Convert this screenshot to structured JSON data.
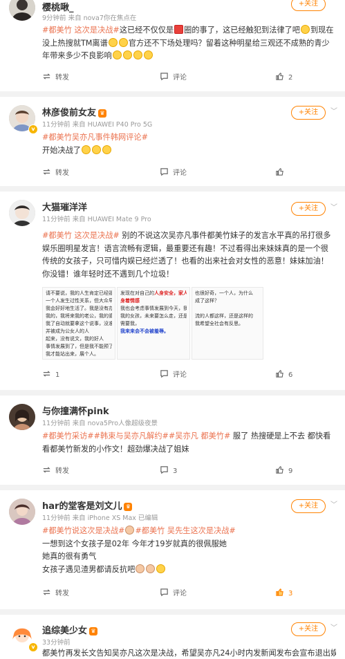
{
  "posts": [
    {
      "name": "樱桃啾_",
      "meta": "9分钟前  来自 nova7你在焦点在",
      "follow": "+关注",
      "tag1": "#都美竹 这次是决战#",
      "text_a": "这已经不仅仅是",
      "text_b": "圈的事了，这已经触犯到法律了吧",
      "text_c": "到现在没上热搜就TM离谱",
      "text_d": "官方还不下场处理吗？留着这种明星给三观还不成熟的青少年带来多少不良影响",
      "repost": "转发",
      "comment": "评论",
      "likes": "2"
    },
    {
      "name": "林彦俊前女友",
      "meta": "11分钟前  来自 HUAWEI P40 Pro 5G",
      "follow": "+关注",
      "tag1": "#都美竹吴亦凡事件韩网评论#",
      "text": "开始决战了",
      "repost": "转发",
      "comment": "评论",
      "likes": ""
    },
    {
      "name": "大猫璀洋洋",
      "meta": "11分钟前  来自 HUAWEI Mate 9 Pro",
      "follow": "+关注",
      "tag1": "#都美竹 这次是决战#",
      "text": "别的不说这次吴亦凡事件都美竹妹子的发言水平真的吊打很多娱乐圈明星发言！语言流畅有逻辑，最重要还有趣！不过看得出来妹妹真的是一个很传统的女孩子，只可惜内娱已经烂透了！也看的出来社会对女性的恶意！妹妹加油！你没错！谁年轻时还不遇到几个垃圾！",
      "thumb1": [
        "请不要说，我的人生肯定已经毁了。",
        "一个人发生过性关系，但大众早已经",
        "我会好好地生活了。我是没有办法",
        "我的，我将来我的老公，我的婆婆",
        "我了自动就要拿这个说事，没准我的孩",
        "并被成为公女人的人",
        "起来，没有说文，我的好人",
        "事情发展到了，但是我不能预了她们的",
        "我才能站出来，展个人。"
      ],
      "thumb2": [
        "发现在对自己的",
        "人身安全，家人",
        "身着情感",
        "我也会考虑事情发展到今天，我",
        "我的女孩，未来要怎么走，还是",
        "需要我，",
        "我来来会不会被羞辱。"
      ],
      "thumb3": [
        "也很好奇，一个人，为什么",
        "成了这样？",
        "流的人都这样，还是这样的",
        "我希望全社会有反思。"
      ],
      "repost": "1",
      "comment": "评论",
      "likes": "6"
    },
    {
      "name": "与你撞满怀pink",
      "meta": "11分钟前  来自 nova5Pro人像超级夜景",
      "follow": "+关注",
      "tag1": "#都美竹采访##韩束与吴亦凡解约##吴亦凡 都美竹#",
      "text": " 服了 热搜硬是上不去 都快看看都美竹新发的小作文！超劲爆决战了姐妹",
      "repost": "转发",
      "comment": "3",
      "likes": "9"
    },
    {
      "name": "har的堂客是刘文儿",
      "meta": "11分钟前  来自 iPhone XS Max 已编辑",
      "follow": "+关注",
      "tag1": "#都美竹说这次是决战#",
      "tag2": "#都美竹 吴先生这次是决战#",
      "line1": "一想到这个女孩子是02年 今年才19岁就真的很佩服她",
      "line2": "她真的很有勇气",
      "line3": "女孩子遇见渣男都请反抗吧",
      "repost": "转发",
      "comment": "评论",
      "likes": "3"
    },
    {
      "name": "追综美少女",
      "meta": "33分钟前",
      "follow": "+关注",
      "text": "都美竹再发长文告知吴亦凡这次是决战，希望吴亦凡24小时内发新闻发布会宣布退出娱"
    }
  ],
  "colors": {
    "accent": "#ff8200",
    "topic": "#eb7350",
    "liked": "#ff8200",
    "meta": "#999999"
  }
}
